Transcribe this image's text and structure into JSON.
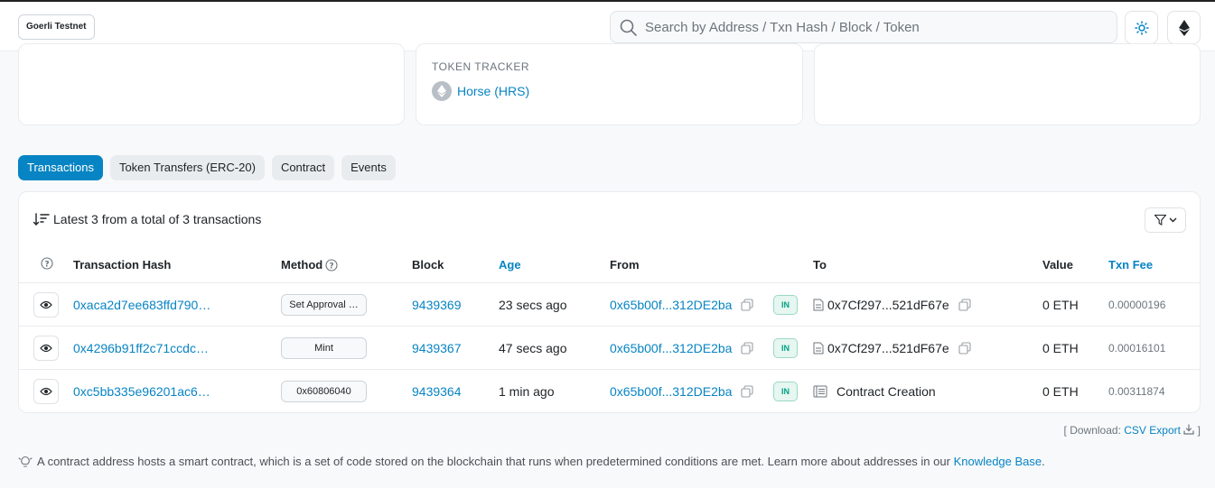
{
  "header": {
    "network": "Goerli Testnet",
    "search_placeholder": "Search by Address / Txn Hash / Block / Token"
  },
  "overview": {
    "token_tracker_label": "TOKEN TRACKER",
    "token_name": "Horse (HRS)"
  },
  "tabs": [
    {
      "label": "Transactions",
      "active": true
    },
    {
      "label": "Token Transfers (ERC-20)",
      "active": false
    },
    {
      "label": "Contract",
      "active": false
    },
    {
      "label": "Events",
      "active": false
    }
  ],
  "transactions": {
    "summary": "Latest 3 from a total of 3 transactions",
    "columns": {
      "hash": "Transaction Hash",
      "method": "Method",
      "block": "Block",
      "age": "Age",
      "from": "From",
      "to": "To",
      "value": "Value",
      "fee": "Txn Fee"
    },
    "rows": [
      {
        "hash": "0xaca2d7ee683ffd790…",
        "method": "Set Approval …",
        "block": "9439369",
        "age": "23 secs ago",
        "from": "0x65b00f...312DE2ba",
        "direction": "IN",
        "to": "0x7Cf297...521dF67e",
        "to_type": "contract",
        "value": "0 ETH",
        "fee": "0.00000196"
      },
      {
        "hash": "0x4296b91ff2c71ccdc…",
        "method": "Mint",
        "block": "9439367",
        "age": "47 secs ago",
        "from": "0x65b00f...312DE2ba",
        "direction": "IN",
        "to": "0x7Cf297...521dF67e",
        "to_type": "contract",
        "value": "0 ETH",
        "fee": "0.00016101"
      },
      {
        "hash": "0xc5bb335e96201ac6…",
        "method": "0x60806040",
        "block": "9439364",
        "age": "1 min ago",
        "from": "0x65b00f...312DE2ba",
        "direction": "IN",
        "to": "Contract Creation",
        "to_type": "creation",
        "value": "0 ETH",
        "fee": "0.00311874"
      }
    ]
  },
  "download": {
    "prefix": "[ Download:",
    "link": "CSV Export",
    "suffix": "]"
  },
  "info": {
    "text": "A contract address hosts a smart contract, which is a set of code stored on the blockchain that runs when predetermined conditions are met. Learn more about addresses in our",
    "link": "Knowledge Base",
    "end": "."
  },
  "colors": {
    "accent": "#0784c3",
    "in_badge": "#00a186"
  }
}
